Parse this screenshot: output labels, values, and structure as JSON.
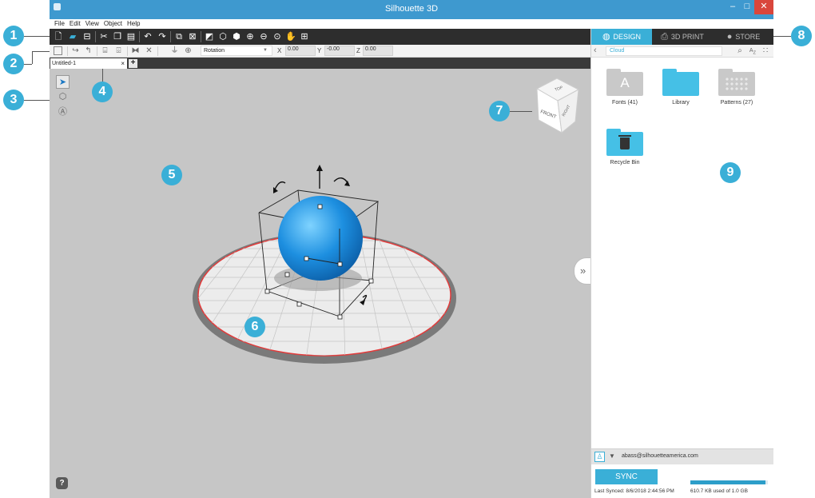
{
  "window": {
    "title": "Silhouette 3D",
    "minimize": "–",
    "maximize": "□",
    "close": "✕"
  },
  "menu": [
    "File",
    "Edit",
    "View",
    "Object",
    "Help"
  ],
  "toolbar1": [
    "new-file-icon",
    "open-folder-icon",
    "save-icon",
    "cut-icon",
    "copy-icon",
    "paste-icon",
    "undo-icon",
    "redo-icon",
    "group-icon",
    "ungroup-icon",
    "shading-icon",
    "view-cube-icon",
    "view-cube-outline-icon",
    "zoom-in-icon",
    "zoom-out-icon",
    "zoom-fit-icon",
    "pan-hand-icon",
    "grid-icon"
  ],
  "toolbar2": {
    "rotation_mode": "Rotation",
    "x_label": "X",
    "x_value": "0.00",
    "y_label": "Y",
    "y_value": "-0.00",
    "z_label": "Z",
    "z_value": "0.00"
  },
  "tabs": {
    "document": "Untitled-1",
    "close": "×",
    "add": "+"
  },
  "viewcube": {
    "top": "TOP",
    "front": "FRONT",
    "right": "RIGHT"
  },
  "callouts": [
    "1",
    "2",
    "3",
    "4",
    "5",
    "6",
    "7",
    "8",
    "9"
  ],
  "panel": {
    "tabs": [
      {
        "label": "DESIGN",
        "icon": "globe-icon",
        "active": true
      },
      {
        "label": "3D PRINT",
        "icon": "printer-icon",
        "active": false
      },
      {
        "label": "STORE",
        "icon": "store-icon",
        "active": false
      }
    ],
    "location": "Cloud",
    "items": [
      {
        "label": "Fonts (41)"
      },
      {
        "label": "Library"
      },
      {
        "label": "Patterns (27)"
      },
      {
        "label": "Recycle Bin"
      }
    ],
    "account_email": "abass@silhouetteamerica.com",
    "sync_label": "SYNC",
    "last_synced": "Last Synced: 8/6/2018 2:44:56 PM",
    "usage": "610.7 KB used of 1.0 GB",
    "usage_fraction": 0.97
  },
  "colors": {
    "accent": "#3aafd7",
    "titlebar": "#3e99cf",
    "sphere": "#1d8fe0",
    "platform_edge": "#e23b3b"
  }
}
